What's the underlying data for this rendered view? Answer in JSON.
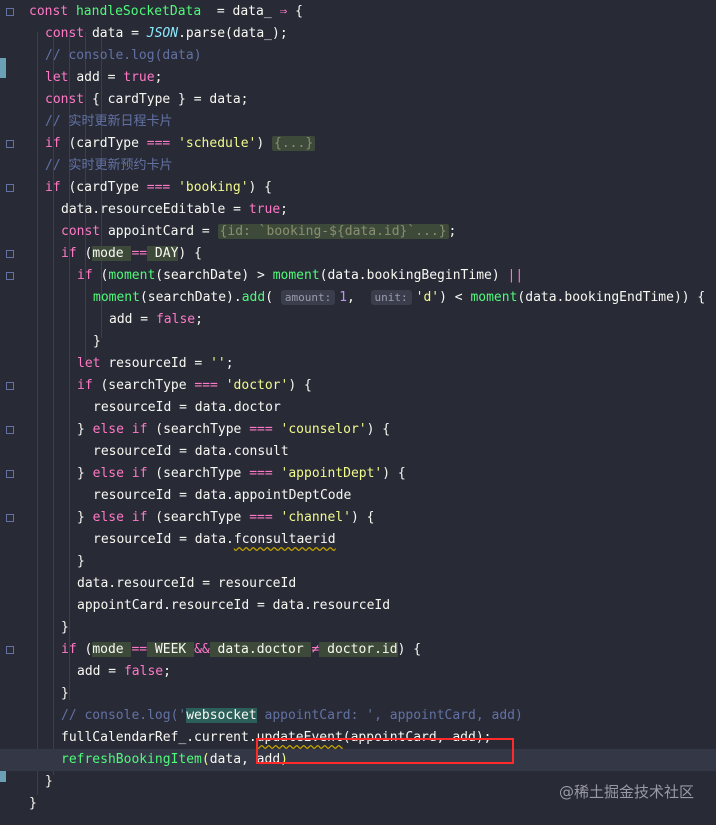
{
  "code": {
    "lines": [
      {
        "parts": [
          [
            "kw",
            "const "
          ],
          [
            "fn",
            "handleSocketData"
          ],
          [
            "",
            "  = data_ "
          ],
          [
            "op",
            "⇒"
          ],
          [
            "",
            " {"
          ]
        ]
      },
      {
        "parts": [
          [
            "kw",
            "const "
          ],
          [
            "",
            "data = "
          ],
          [
            "cls",
            "JSON"
          ],
          [
            "",
            ".parse(data_);"
          ]
        ]
      },
      {
        "parts": [
          [
            "cm",
            "// console.log(data)"
          ]
        ]
      },
      {
        "parts": [
          [
            "kw",
            "let "
          ],
          [
            "",
            "add = "
          ],
          [
            "bool",
            "true"
          ],
          [
            "",
            ";"
          ]
        ]
      },
      {
        "parts": [
          [
            "kw",
            "const "
          ],
          [
            "",
            "{ cardType } = data;"
          ]
        ]
      },
      {
        "parts": [
          [
            "cm",
            "// 实时更新日程卡片"
          ]
        ]
      },
      {
        "parts": [
          [
            "kw",
            "if "
          ],
          [
            "",
            "(cardType "
          ],
          [
            "op",
            "==="
          ],
          [
            "",
            " "
          ],
          [
            "str",
            "'schedule'"
          ],
          [
            "",
            ") "
          ],
          [
            "fold",
            "{...}"
          ]
        ]
      },
      {
        "parts": [
          [
            "cm",
            "// 实时更新预约卡片"
          ]
        ]
      },
      {
        "parts": [
          [
            "kw",
            "if "
          ],
          [
            "",
            "(cardType "
          ],
          [
            "op",
            "==="
          ],
          [
            "",
            " "
          ],
          [
            "str",
            "'booking'"
          ],
          [
            "",
            ") {"
          ]
        ]
      },
      {
        "parts": [
          [
            "",
            "data.resourceEditable = "
          ],
          [
            "bool",
            "true"
          ],
          [
            "",
            ";"
          ]
        ]
      },
      {
        "parts": [
          [
            "kw",
            "const "
          ],
          [
            "",
            "appointCard = "
          ],
          [
            "fold",
            "{id: `booking-${data.id}`...}"
          ],
          [
            "",
            ";"
          ]
        ]
      },
      {
        "parts": [
          [
            "kw",
            "if "
          ],
          [
            "",
            "("
          ],
          [
            "hl",
            "mode "
          ],
          [
            "op",
            "=="
          ],
          [
            "hl",
            " DAY"
          ],
          [
            "",
            ") {"
          ]
        ]
      },
      {
        "parts": [
          [
            "kw",
            "if "
          ],
          [
            "",
            "("
          ],
          [
            "fn",
            "moment"
          ],
          [
            "",
            "(searchDate) > "
          ],
          [
            "fn",
            "moment"
          ],
          [
            "",
            "(data.bookingBeginTime) "
          ],
          [
            "op",
            "||"
          ]
        ]
      },
      {
        "parts": [
          [
            "fn",
            "moment"
          ],
          [
            "",
            "(searchDate)."
          ],
          [
            "fn",
            "add"
          ],
          [
            "",
            "( "
          ],
          [
            "hint",
            "amount:"
          ],
          [
            "num",
            "1"
          ],
          [
            "",
            ",  "
          ],
          [
            "hint",
            "unit:"
          ],
          [
            "str",
            "'d'"
          ],
          [
            "",
            ") < "
          ],
          [
            "fn",
            "moment"
          ],
          [
            "",
            "(data.bookingEndTime)) {"
          ]
        ]
      },
      {
        "parts": [
          [
            "",
            "add = "
          ],
          [
            "bool",
            "false"
          ],
          [
            "",
            ";"
          ]
        ]
      },
      {
        "parts": [
          [
            "",
            "}"
          ]
        ]
      },
      {
        "parts": [
          [
            "kw",
            "let "
          ],
          [
            "",
            "resourceId = "
          ],
          [
            "str",
            "''"
          ],
          [
            "",
            ";"
          ]
        ]
      },
      {
        "parts": [
          [
            "kw",
            "if "
          ],
          [
            "",
            "(searchType "
          ],
          [
            "op",
            "==="
          ],
          [
            "",
            " "
          ],
          [
            "str",
            "'doctor'"
          ],
          [
            "",
            ") {"
          ]
        ]
      },
      {
        "parts": [
          [
            "",
            "resourceId = data.doctor"
          ]
        ]
      },
      {
        "parts": [
          [
            "",
            "} "
          ],
          [
            "kw",
            "else if "
          ],
          [
            "",
            "(searchType "
          ],
          [
            "op",
            "==="
          ],
          [
            "",
            " "
          ],
          [
            "str",
            "'counselor'"
          ],
          [
            "",
            ") {"
          ]
        ]
      },
      {
        "parts": [
          [
            "",
            "resourceId = data.consult"
          ]
        ]
      },
      {
        "parts": [
          [
            "",
            "} "
          ],
          [
            "kw",
            "else if "
          ],
          [
            "",
            "(searchType "
          ],
          [
            "op",
            "==="
          ],
          [
            "",
            " "
          ],
          [
            "str",
            "'appointDept'"
          ],
          [
            "",
            ") {"
          ]
        ]
      },
      {
        "parts": [
          [
            "",
            "resourceId = data.appointDeptCode"
          ]
        ]
      },
      {
        "parts": [
          [
            "",
            "} "
          ],
          [
            "kw",
            "else if "
          ],
          [
            "",
            "(searchType "
          ],
          [
            "op",
            "==="
          ],
          [
            "",
            " "
          ],
          [
            "str",
            "'channel'"
          ],
          [
            "",
            ") {"
          ]
        ]
      },
      {
        "parts": [
          [
            "",
            "resourceId = data."
          ],
          [
            "sq",
            "fconsultaerid"
          ]
        ]
      },
      {
        "parts": [
          [
            "",
            "}"
          ]
        ]
      },
      {
        "parts": [
          [
            "",
            "data.resourceId = resourceId"
          ]
        ]
      },
      {
        "parts": [
          [
            "",
            "appointCard.resourceId = data.resourceId"
          ]
        ]
      },
      {
        "parts": [
          [
            "",
            "}"
          ]
        ]
      },
      {
        "parts": [
          [
            "kw",
            "if "
          ],
          [
            "",
            "("
          ],
          [
            "hl",
            "mode "
          ],
          [
            "op",
            "=="
          ],
          [
            "hl",
            " WEEK "
          ],
          [
            "op",
            "&&"
          ],
          [
            "hl",
            " data.doctor "
          ],
          [
            "op",
            "≠"
          ],
          [
            "hl",
            " doctor.id"
          ],
          [
            "",
            ") {"
          ]
        ]
      },
      {
        "parts": [
          [
            "",
            "add = "
          ],
          [
            "bool",
            "false"
          ],
          [
            "",
            ";"
          ]
        ]
      },
      {
        "parts": [
          [
            "",
            "}"
          ]
        ]
      },
      {
        "parts": [
          [
            "cm",
            "// console.log('"
          ],
          [
            "ws",
            "websocket"
          ],
          [
            "cm",
            " appointCard: ', appointCard, add)"
          ]
        ]
      },
      {
        "parts": [
          [
            "",
            "fullCalendarRef_.current."
          ],
          [
            "sq",
            "updateEvent"
          ],
          [
            "",
            "(appointCard, add);"
          ]
        ]
      },
      {
        "parts": [
          [
            "fn",
            "refreshBookingItem"
          ],
          [
            "str",
            "("
          ],
          [
            "",
            "data, add"
          ],
          [
            "str",
            ")"
          ]
        ]
      },
      {
        "parts": [
          [
            "",
            "}"
          ]
        ]
      },
      {
        "parts": [
          [
            "",
            "}"
          ]
        ]
      }
    ]
  },
  "watermark": "@稀土掘金技术社区"
}
